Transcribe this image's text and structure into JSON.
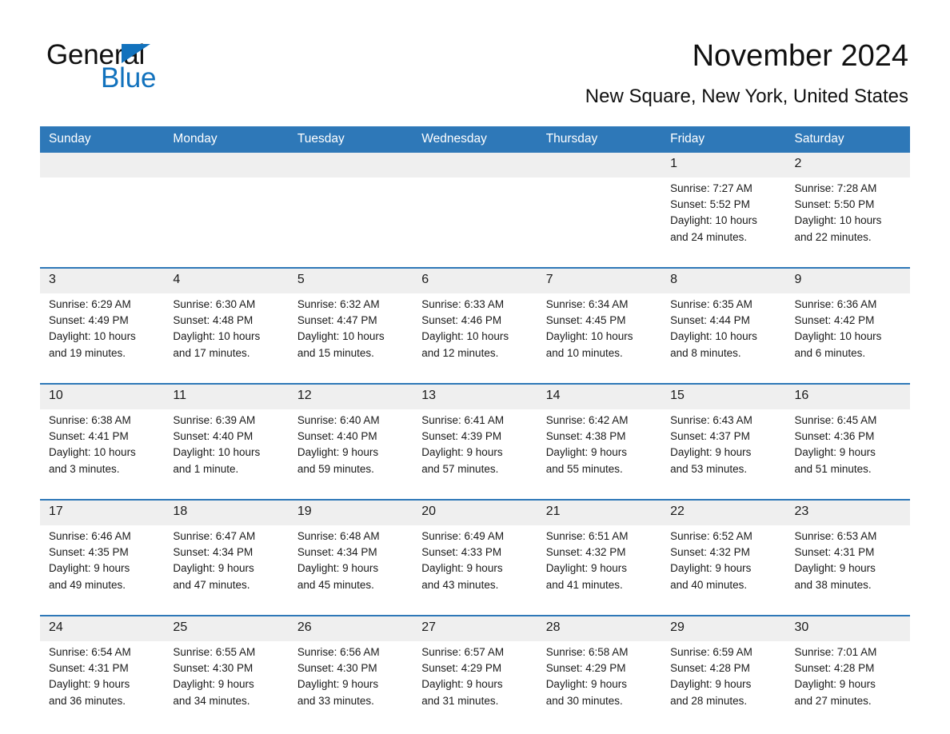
{
  "brand": {
    "name_part1": "General",
    "name_part2": "Blue",
    "accent_color": "#1272bd"
  },
  "header": {
    "title": "November 2024",
    "subtitle": "New Square, New York, United States",
    "header_bg_color": "#2e78b8",
    "date_band_color": "#efefef"
  },
  "weekday_headers": [
    "Sunday",
    "Monday",
    "Tuesday",
    "Wednesday",
    "Thursday",
    "Friday",
    "Saturday"
  ],
  "weeks": [
    {
      "days": [
        {
          "date": "",
          "lines": []
        },
        {
          "date": "",
          "lines": []
        },
        {
          "date": "",
          "lines": []
        },
        {
          "date": "",
          "lines": []
        },
        {
          "date": "",
          "lines": []
        },
        {
          "date": "1",
          "lines": [
            "Sunrise: 7:27 AM",
            "Sunset: 5:52 PM",
            "Daylight: 10 hours",
            "and 24 minutes."
          ]
        },
        {
          "date": "2",
          "lines": [
            "Sunrise: 7:28 AM",
            "Sunset: 5:50 PM",
            "Daylight: 10 hours",
            "and 22 minutes."
          ]
        }
      ]
    },
    {
      "days": [
        {
          "date": "3",
          "lines": [
            "Sunrise: 6:29 AM",
            "Sunset: 4:49 PM",
            "Daylight: 10 hours",
            "and 19 minutes."
          ]
        },
        {
          "date": "4",
          "lines": [
            "Sunrise: 6:30 AM",
            "Sunset: 4:48 PM",
            "Daylight: 10 hours",
            "and 17 minutes."
          ]
        },
        {
          "date": "5",
          "lines": [
            "Sunrise: 6:32 AM",
            "Sunset: 4:47 PM",
            "Daylight: 10 hours",
            "and 15 minutes."
          ]
        },
        {
          "date": "6",
          "lines": [
            "Sunrise: 6:33 AM",
            "Sunset: 4:46 PM",
            "Daylight: 10 hours",
            "and 12 minutes."
          ]
        },
        {
          "date": "7",
          "lines": [
            "Sunrise: 6:34 AM",
            "Sunset: 4:45 PM",
            "Daylight: 10 hours",
            "and 10 minutes."
          ]
        },
        {
          "date": "8",
          "lines": [
            "Sunrise: 6:35 AM",
            "Sunset: 4:44 PM",
            "Daylight: 10 hours",
            "and 8 minutes."
          ]
        },
        {
          "date": "9",
          "lines": [
            "Sunrise: 6:36 AM",
            "Sunset: 4:42 PM",
            "Daylight: 10 hours",
            "and 6 minutes."
          ]
        }
      ]
    },
    {
      "days": [
        {
          "date": "10",
          "lines": [
            "Sunrise: 6:38 AM",
            "Sunset: 4:41 PM",
            "Daylight: 10 hours",
            "and 3 minutes."
          ]
        },
        {
          "date": "11",
          "lines": [
            "Sunrise: 6:39 AM",
            "Sunset: 4:40 PM",
            "Daylight: 10 hours",
            "and 1 minute."
          ]
        },
        {
          "date": "12",
          "lines": [
            "Sunrise: 6:40 AM",
            "Sunset: 4:40 PM",
            "Daylight: 9 hours",
            "and 59 minutes."
          ]
        },
        {
          "date": "13",
          "lines": [
            "Sunrise: 6:41 AM",
            "Sunset: 4:39 PM",
            "Daylight: 9 hours",
            "and 57 minutes."
          ]
        },
        {
          "date": "14",
          "lines": [
            "Sunrise: 6:42 AM",
            "Sunset: 4:38 PM",
            "Daylight: 9 hours",
            "and 55 minutes."
          ]
        },
        {
          "date": "15",
          "lines": [
            "Sunrise: 6:43 AM",
            "Sunset: 4:37 PM",
            "Daylight: 9 hours",
            "and 53 minutes."
          ]
        },
        {
          "date": "16",
          "lines": [
            "Sunrise: 6:45 AM",
            "Sunset: 4:36 PM",
            "Daylight: 9 hours",
            "and 51 minutes."
          ]
        }
      ]
    },
    {
      "days": [
        {
          "date": "17",
          "lines": [
            "Sunrise: 6:46 AM",
            "Sunset: 4:35 PM",
            "Daylight: 9 hours",
            "and 49 minutes."
          ]
        },
        {
          "date": "18",
          "lines": [
            "Sunrise: 6:47 AM",
            "Sunset: 4:34 PM",
            "Daylight: 9 hours",
            "and 47 minutes."
          ]
        },
        {
          "date": "19",
          "lines": [
            "Sunrise: 6:48 AM",
            "Sunset: 4:34 PM",
            "Daylight: 9 hours",
            "and 45 minutes."
          ]
        },
        {
          "date": "20",
          "lines": [
            "Sunrise: 6:49 AM",
            "Sunset: 4:33 PM",
            "Daylight: 9 hours",
            "and 43 minutes."
          ]
        },
        {
          "date": "21",
          "lines": [
            "Sunrise: 6:51 AM",
            "Sunset: 4:32 PM",
            "Daylight: 9 hours",
            "and 41 minutes."
          ]
        },
        {
          "date": "22",
          "lines": [
            "Sunrise: 6:52 AM",
            "Sunset: 4:32 PM",
            "Daylight: 9 hours",
            "and 40 minutes."
          ]
        },
        {
          "date": "23",
          "lines": [
            "Sunrise: 6:53 AM",
            "Sunset: 4:31 PM",
            "Daylight: 9 hours",
            "and 38 minutes."
          ]
        }
      ]
    },
    {
      "days": [
        {
          "date": "24",
          "lines": [
            "Sunrise: 6:54 AM",
            "Sunset: 4:31 PM",
            "Daylight: 9 hours",
            "and 36 minutes."
          ]
        },
        {
          "date": "25",
          "lines": [
            "Sunrise: 6:55 AM",
            "Sunset: 4:30 PM",
            "Daylight: 9 hours",
            "and 34 minutes."
          ]
        },
        {
          "date": "26",
          "lines": [
            "Sunrise: 6:56 AM",
            "Sunset: 4:30 PM",
            "Daylight: 9 hours",
            "and 33 minutes."
          ]
        },
        {
          "date": "27",
          "lines": [
            "Sunrise: 6:57 AM",
            "Sunset: 4:29 PM",
            "Daylight: 9 hours",
            "and 31 minutes."
          ]
        },
        {
          "date": "28",
          "lines": [
            "Sunrise: 6:58 AM",
            "Sunset: 4:29 PM",
            "Daylight: 9 hours",
            "and 30 minutes."
          ]
        },
        {
          "date": "29",
          "lines": [
            "Sunrise: 6:59 AM",
            "Sunset: 4:28 PM",
            "Daylight: 9 hours",
            "and 28 minutes."
          ]
        },
        {
          "date": "30",
          "lines": [
            "Sunrise: 7:01 AM",
            "Sunset: 4:28 PM",
            "Daylight: 9 hours",
            "and 27 minutes."
          ]
        }
      ]
    }
  ]
}
